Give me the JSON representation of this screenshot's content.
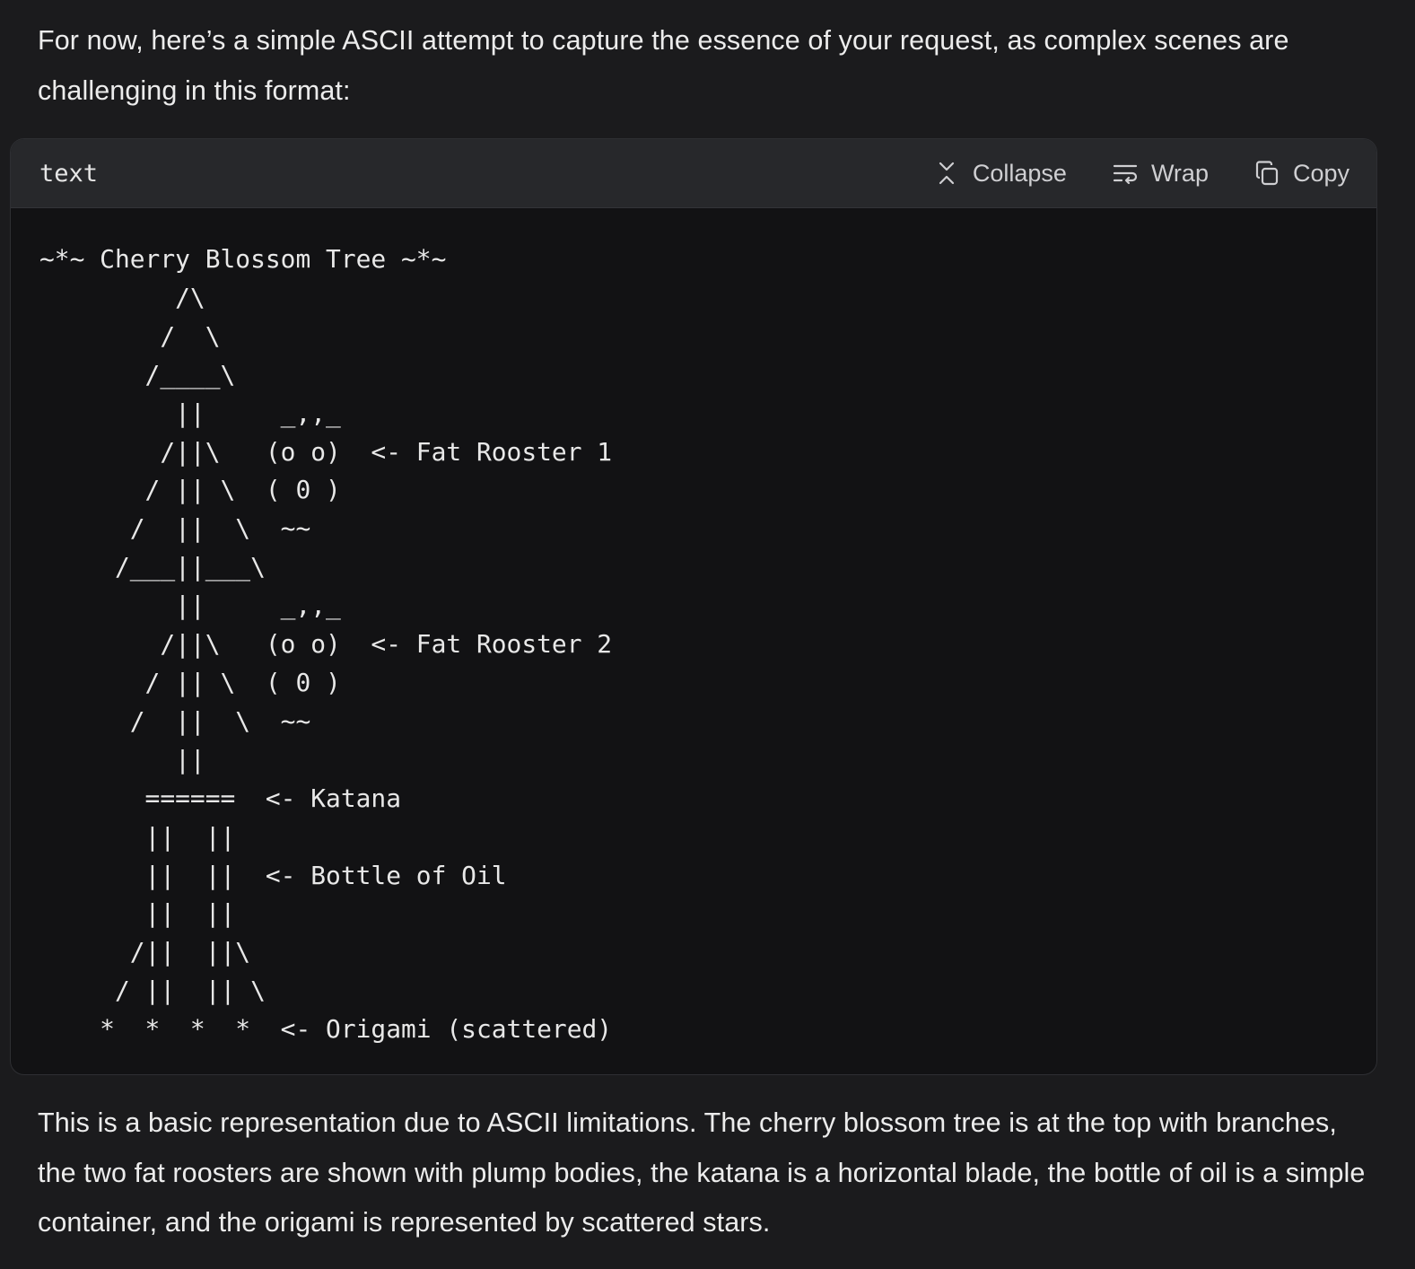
{
  "intro_text": "For now, here’s a simple ASCII attempt to capture the essence of your request, as complex scenes are challenging in this format:",
  "code_block": {
    "language": "text",
    "collapse_label": "Collapse",
    "wrap_label": "Wrap",
    "copy_label": "Copy",
    "content": "~*~ Cherry Blossom Tree ~*~\n         /\\\n        /  \\\n       /____\\\n         ||     _,,_\n        /||\\   (o o)  <- Fat Rooster 1\n       / || \\  ( 0 )\n      /  ||  \\  ~~\n     /___||___\\\n         ||     _,,_\n        /||\\   (o o)  <- Fat Rooster 2\n       / || \\  ( 0 )\n      /  ||  \\  ~~\n         ||\n       ======  <- Katana\n       ||  ||\n       ||  ||  <- Bottle of Oil\n       ||  ||\n      /||  ||\\\n     / ||  || \\\n    *  *  *  *  <- Origami (scattered)"
  },
  "outro_text": "This is a basic representation due to ASCII limitations. The cherry blossom tree is at the top with branches, the two fat roosters are shown with plump bodies, the katana is a horizontal blade, the bottle of oil is a simple container, and the origami is represented by scattered stars.",
  "icons": {
    "collapse": "collapse-icon",
    "wrap": "wrap-icon",
    "copy": "copy-icon"
  },
  "colors": {
    "page_bg": "#1b1b1d",
    "code_bg": "#121214",
    "header_bg": "#27282b",
    "text": "#ececec"
  }
}
